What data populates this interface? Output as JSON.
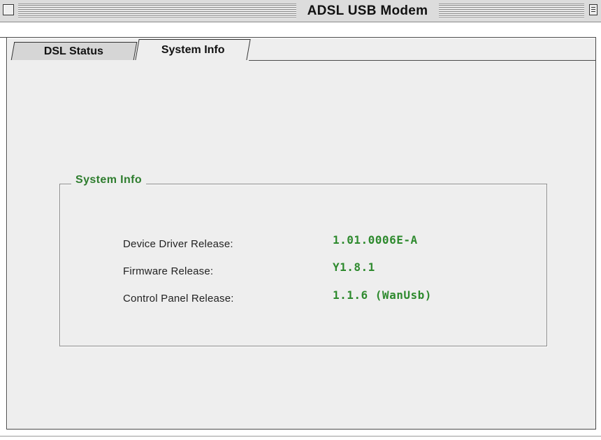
{
  "window": {
    "title": "ADSL USB Modem"
  },
  "tabs": [
    {
      "label": "DSL Status",
      "selected": false
    },
    {
      "label": "System Info",
      "selected": true
    }
  ],
  "system_info": {
    "group_title": "System Info",
    "rows": [
      {
        "label": "Device Driver Release:",
        "value": "1.01.0006E-A"
      },
      {
        "label": "Firmware Release:",
        "value": "Y1.8.1"
      },
      {
        "label": "Control Panel Release:",
        "value": "1.1.6 (WanUsb)"
      }
    ]
  },
  "colors": {
    "value_text": "#2e8a2e",
    "group_title": "#2e7d2e",
    "panel_bg": "#eeeeee"
  }
}
